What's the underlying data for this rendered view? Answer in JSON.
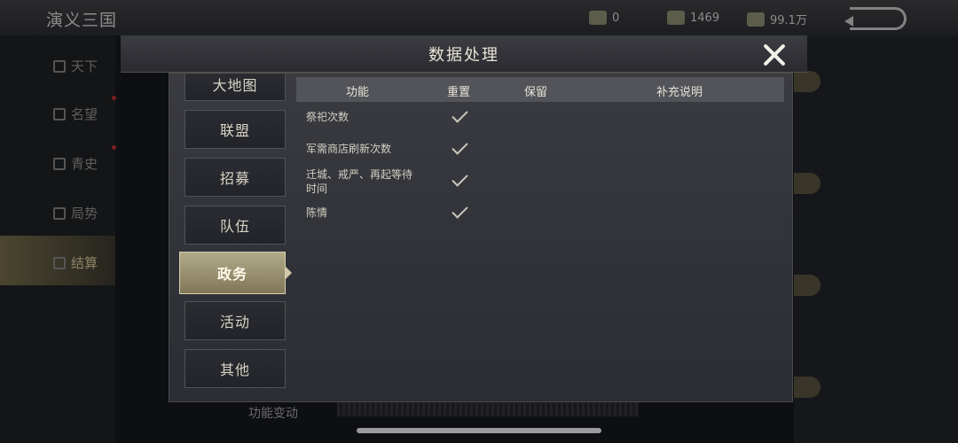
{
  "background": {
    "title": "演义三国",
    "resources": [
      {
        "icon": "gold-ingot-icon",
        "value": "0"
      },
      {
        "icon": "copper-coin-icon",
        "value": "1469"
      },
      {
        "icon": "food-icon",
        "value": "99.1万"
      }
    ],
    "sidebar": [
      {
        "label": "天下",
        "icon": "world-icon"
      },
      {
        "label": "名望",
        "icon": "prestige-icon"
      },
      {
        "label": "青史",
        "icon": "history-icon"
      },
      {
        "label": "局势",
        "icon": "situation-icon"
      },
      {
        "label": "结算",
        "icon": "settlement-icon"
      }
    ],
    "bottom_text": "功能变动"
  },
  "dialog": {
    "title": "数据处理",
    "nav": [
      {
        "label": "大地图"
      },
      {
        "label": "联盟"
      },
      {
        "label": "招募"
      },
      {
        "label": "队伍"
      },
      {
        "label": "政务",
        "active": true
      },
      {
        "label": "活动"
      },
      {
        "label": "其他"
      }
    ],
    "table": {
      "headers": [
        "功能",
        "重置",
        "保留",
        "补充说明"
      ],
      "rows": [
        {
          "function": "祭祀次数",
          "reset": true,
          "keep": false,
          "note": ""
        },
        {
          "function": "军需商店刷新次数",
          "reset": true,
          "keep": false,
          "note": ""
        },
        {
          "function": "迁城、戒严、再起等待时间",
          "reset": true,
          "keep": false,
          "note": ""
        },
        {
          "function": "陈情",
          "reset": true,
          "keep": false,
          "note": ""
        }
      ]
    }
  }
}
